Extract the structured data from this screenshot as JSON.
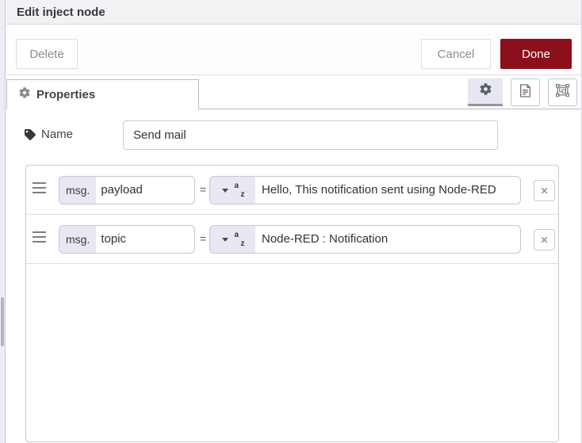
{
  "dialog": {
    "title": "Edit inject node",
    "delete_label": "Delete",
    "cancel_label": "Cancel",
    "done_label": "Done"
  },
  "tabs": {
    "properties_label": "Properties"
  },
  "toolbar_icons": [
    "gear-icon",
    "doc-icon",
    "appearance-icon"
  ],
  "name": {
    "label": "Name",
    "value": "Send mail"
  },
  "rows": [
    {
      "prefix": "msg.",
      "key": "payload",
      "eq": "=",
      "type": "string (a-z)",
      "value": "Hello, This notification sent using Node-RED"
    },
    {
      "prefix": "msg.",
      "key": "topic",
      "eq": "=",
      "type": "string (a-z)",
      "value": "Node-RED : Notification"
    }
  ],
  "icons": {
    "az_a": "a",
    "az_z": "z",
    "remove": "✕"
  },
  "colors": {
    "accent_red": "#8C101C",
    "field_lavender": "#E8E8F2",
    "header_bg": "#F2F2F4"
  }
}
